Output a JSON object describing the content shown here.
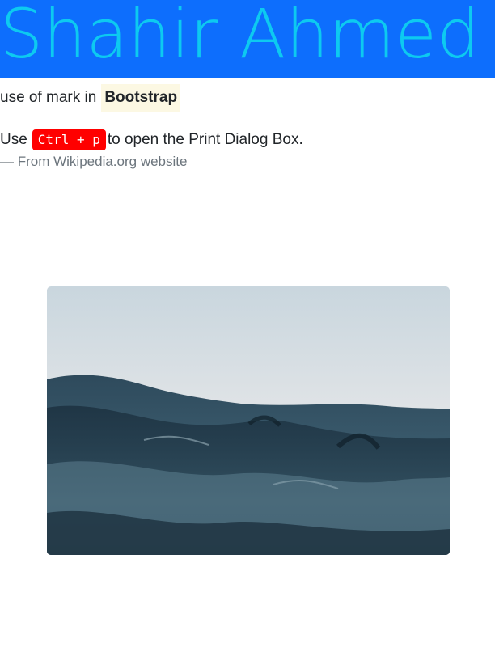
{
  "banner": {
    "title": "Shahir Ahmed",
    "background_color": "#0d6efd",
    "text_color": "#0dcaf0"
  },
  "mark_line": {
    "prefix": "use of mark in",
    "marked": "Bootstrap",
    "mark_color": "#fcf8e3"
  },
  "quote": {
    "before": "Use",
    "kbd": "Ctrl + p",
    "after": "to open the Print Dialog Box.",
    "kbd_color": "#ff0000"
  },
  "footer": {
    "text": "— From Wikipedia.org website"
  },
  "image": {
    "subject": "ocean-waves-photo"
  }
}
